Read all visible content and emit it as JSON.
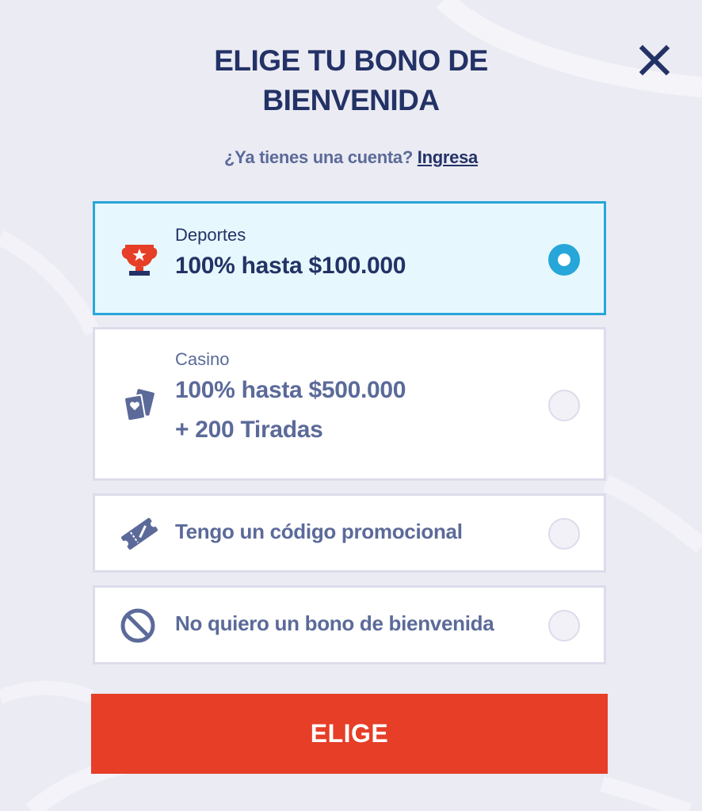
{
  "modal": {
    "title_line1": "ELIGE TU BONO DE",
    "title_line2": "BIENVENIDA",
    "close_icon": "close-icon"
  },
  "login": {
    "prompt": "¿Ya tienes una cuenta?",
    "link": "Ingresa"
  },
  "options": [
    {
      "category": "Deportes",
      "line1": "100% hasta $100.000",
      "icon": "trophy-icon",
      "selected": true
    },
    {
      "category": "Casino",
      "line1": "100% hasta $500.000",
      "line2": "+ 200 Tiradas",
      "icon": "cards-icon",
      "selected": false
    },
    {
      "label": "Tengo un código promocional",
      "icon": "ticket-icon",
      "selected": false
    },
    {
      "label": "No quiero un bono de bienvenida",
      "icon": "prohibited-icon",
      "selected": false
    }
  ],
  "cta": {
    "label": "ELIGE"
  },
  "colors": {
    "navy": "#233266",
    "muted": "#5b6a99",
    "accent_blue": "#27a6d9",
    "cta_red": "#e63e27",
    "background": "#ebebf3"
  }
}
